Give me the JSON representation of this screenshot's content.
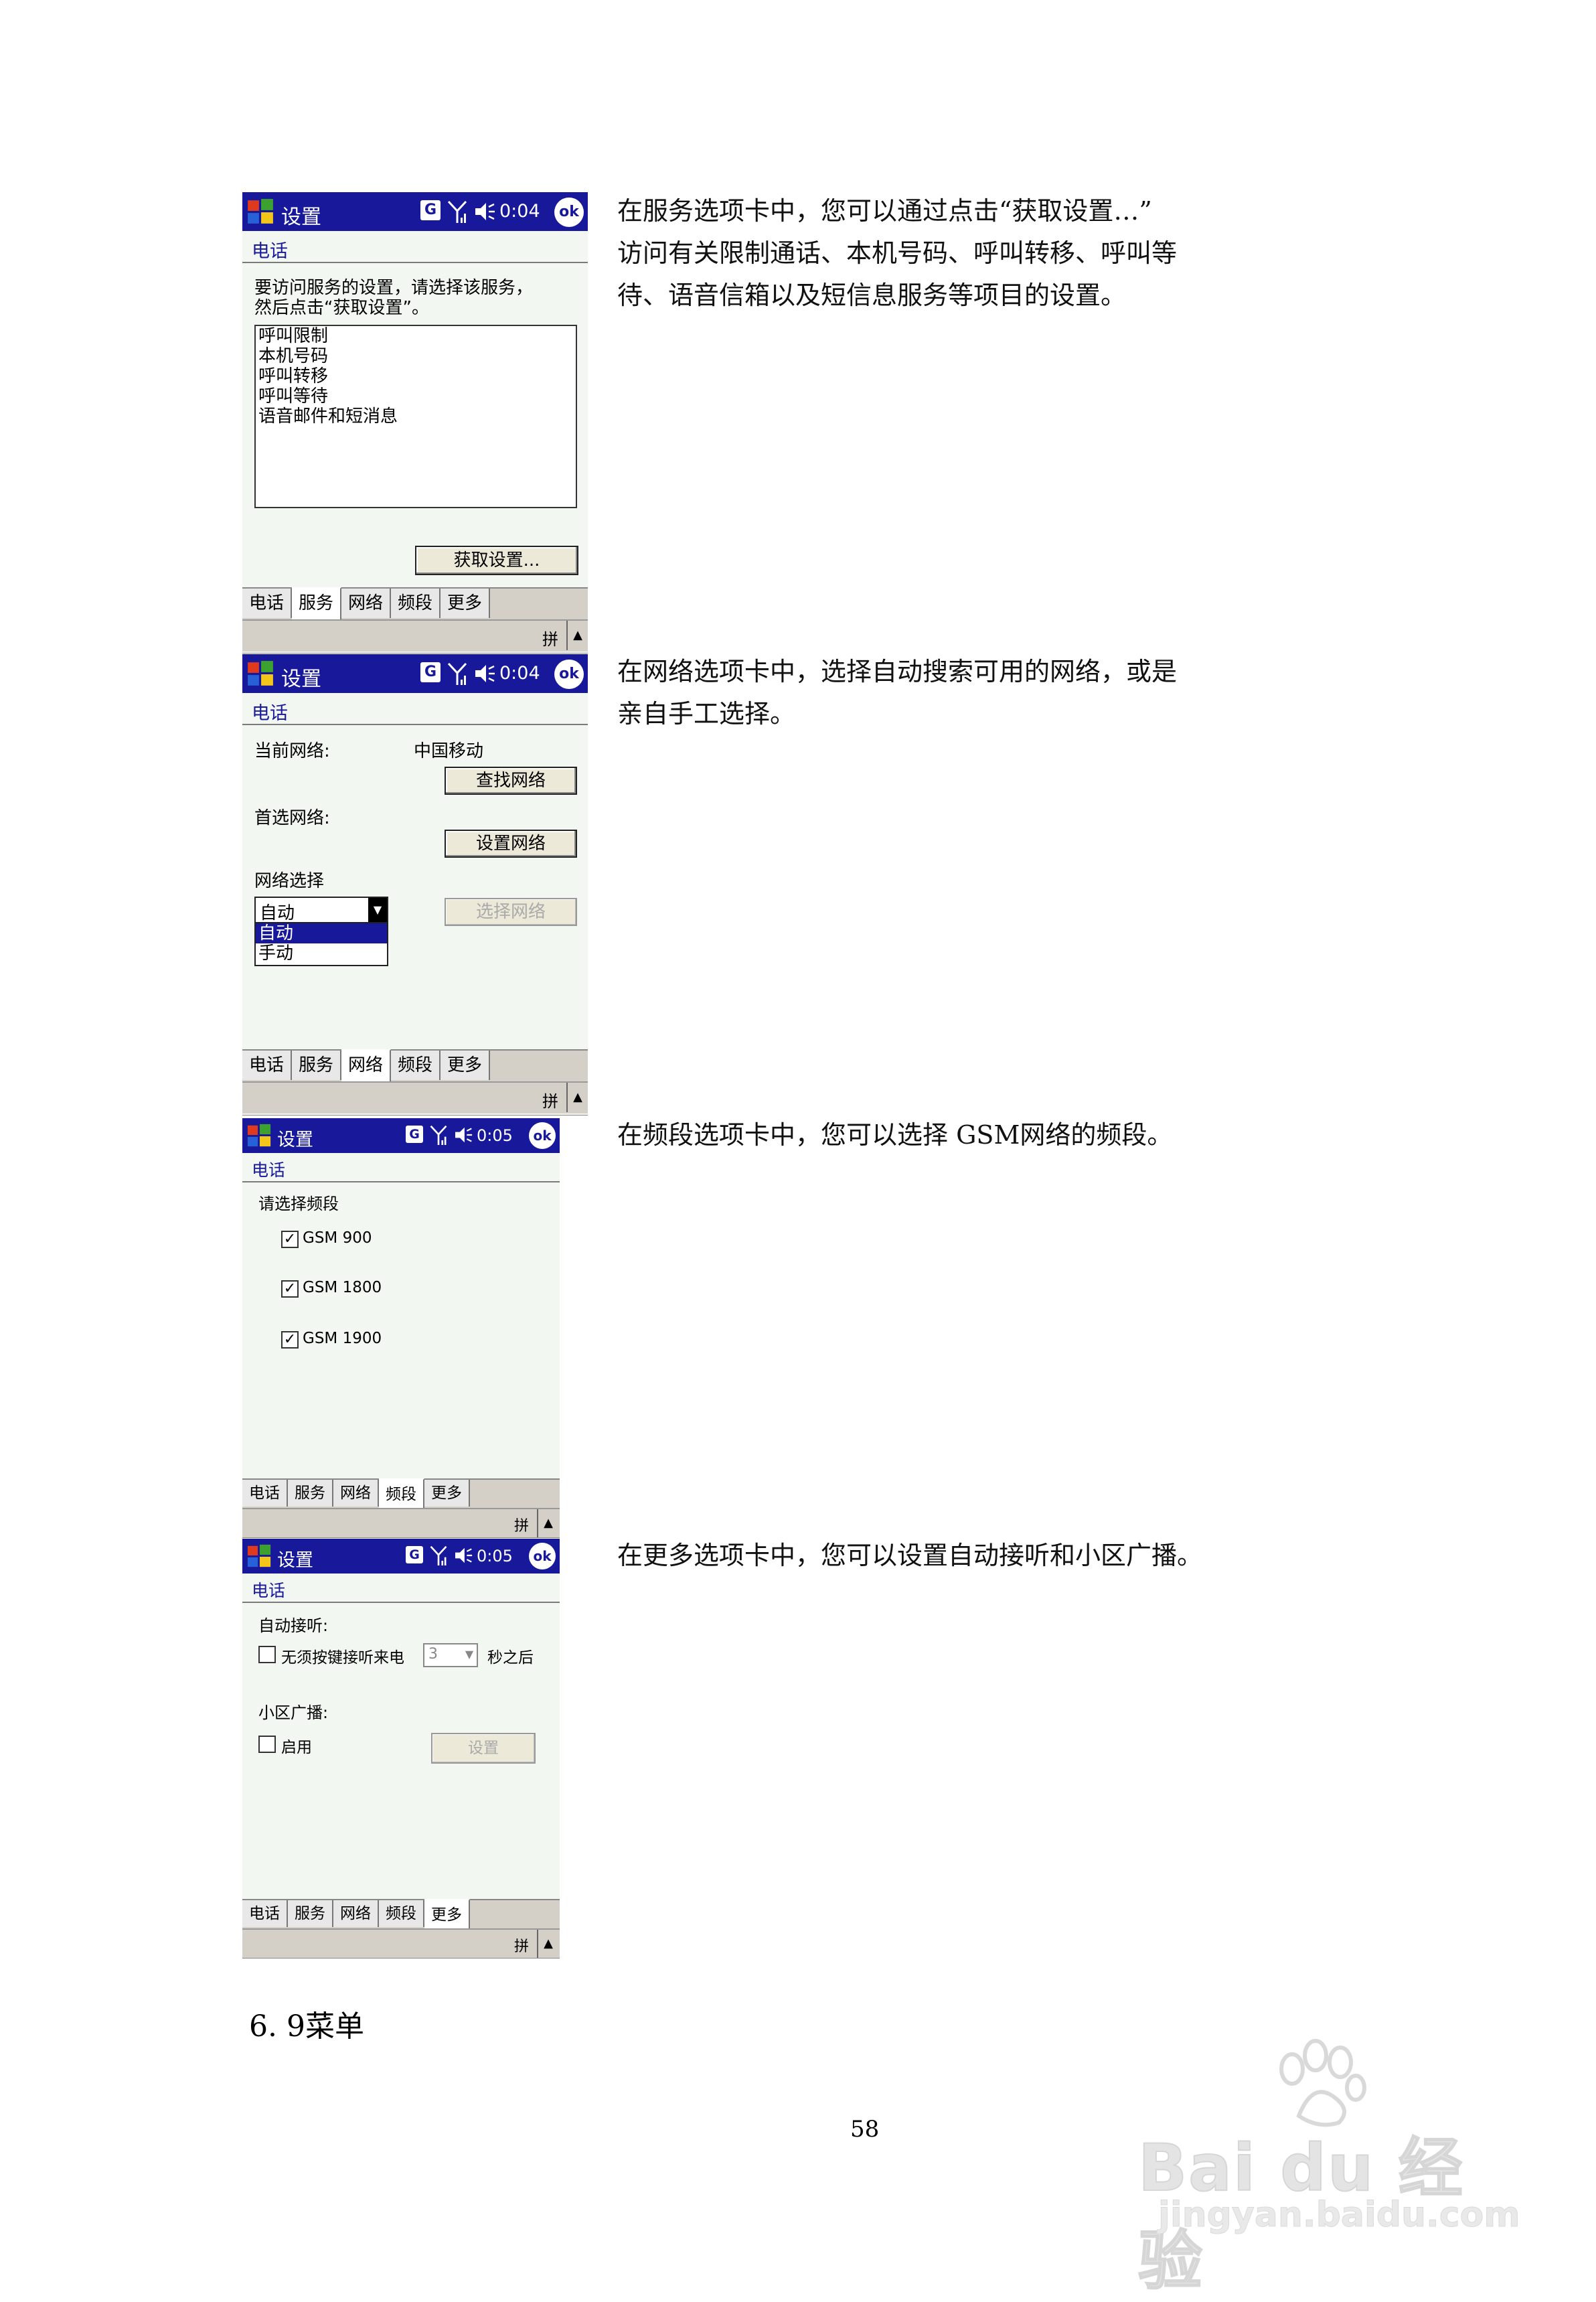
{
  "screens": [
    {
      "title": "设置",
      "time": "0:04",
      "ok": "ok",
      "g": "G",
      "heading": "电话",
      "instruction_line1": "要访问服务的设置，请选择该服务，",
      "instruction_line2": "然后点击“获取设置”。",
      "services": [
        "呼叫限制",
        "本机号码",
        "呼叫转移",
        "呼叫等待",
        "语音邮件和短消息"
      ],
      "get_settings_button": "获取设置...",
      "tabs": [
        "电话",
        "服务",
        "网络",
        "频段",
        "更多"
      ],
      "active_tab": "服务",
      "sip_label": "拼",
      "sip_arrow": "▲"
    },
    {
      "title": "设置",
      "time": "0:04",
      "ok": "ok",
      "g": "G",
      "heading": "电话",
      "current_network_label": "当前网络:",
      "current_network_value": "中国移动",
      "find_network_button": "查找网络",
      "preferred_network_label": "首选网络:",
      "set_network_button": "设置网络",
      "network_selection_label": "网络选择",
      "network_selection_value": "自动",
      "network_options": [
        "自动",
        "手动"
      ],
      "select_network_button": "选择网络",
      "tabs": [
        "电话",
        "服务",
        "网络",
        "频段",
        "更多"
      ],
      "active_tab": "网络",
      "sip_label": "拼",
      "sip_arrow": "▲"
    },
    {
      "title": "设置",
      "time": "0:05",
      "ok": "ok",
      "g": "G",
      "heading": "电话",
      "band_prompt": "请选择频段",
      "bands": [
        {
          "label": "GSM 900",
          "checked": true
        },
        {
          "label": "GSM 1800",
          "checked": true
        },
        {
          "label": "GSM 1900",
          "checked": true
        }
      ],
      "tabs": [
        "电话",
        "服务",
        "网络",
        "频段",
        "更多"
      ],
      "active_tab": "频段",
      "sip_label": "拼",
      "sip_arrow": "▲"
    },
    {
      "title": "设置",
      "time": "0:05",
      "ok": "ok",
      "g": "G",
      "heading": "电话",
      "auto_answer_label": "自动接听:",
      "auto_answer_checkbox": "无须按键接听来电",
      "auto_answer_seconds": "3",
      "auto_answer_suffix": "秒之后",
      "cell_broadcast_label": "小区广播:",
      "enable_checkbox": "启用",
      "settings_button": "设置",
      "tabs": [
        "电话",
        "服务",
        "网络",
        "频段",
        "更多"
      ],
      "active_tab": "更多",
      "sip_label": "拼",
      "sip_arrow": "▲"
    }
  ],
  "descriptions": [
    [
      "在服务选项卡中，您可以通过点击“获取设置…”",
      "访问有关限制通话、本机号码、呼叫转移、呼叫等",
      "待、语音信箱以及短信息服务等项目的设置。"
    ],
    [
      "在网络选项卡中，选择自动搜索可用的网络，或是",
      "亲自手工选择。"
    ],
    [
      "在频段选项卡中，您可以选择 GSM网络的频段。"
    ],
    [
      "在更多选项卡中，您可以设置自动接听和小区广播。"
    ]
  ],
  "section_heading": "6. 9菜单",
  "page_number": "58",
  "watermark": {
    "line1": "Bai du 经验",
    "line2": "jingyan.baidu.com"
  }
}
